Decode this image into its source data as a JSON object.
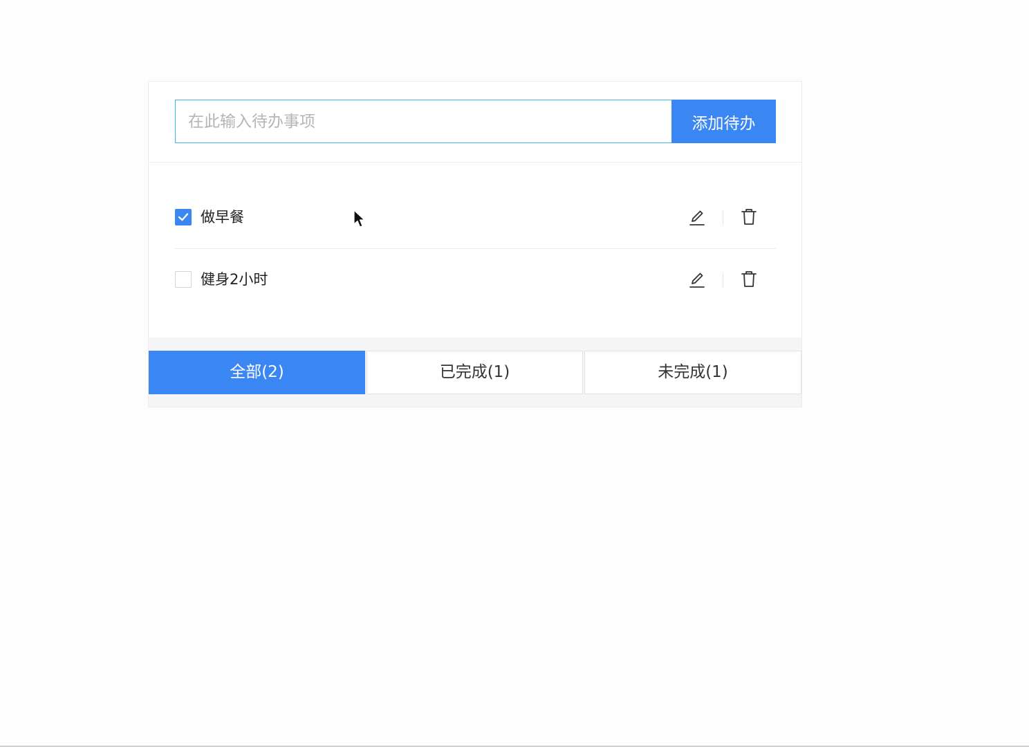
{
  "input": {
    "value": "",
    "placeholder": "在此输入待办事项"
  },
  "add_button_label": "添加待办",
  "todos": [
    {
      "label": "做早餐",
      "checked": true
    },
    {
      "label": "健身2小时",
      "checked": false
    }
  ],
  "filters": [
    {
      "label": "全部(2)",
      "active": true
    },
    {
      "label": "已完成(1)",
      "active": false
    },
    {
      "label": "未完成(1)",
      "active": false
    }
  ],
  "icons": {
    "edit": "pencil-icon",
    "delete": "trash-icon",
    "check": "check-icon",
    "cursor": "mouse-pointer-icon"
  },
  "colors": {
    "accent": "#3a86f2",
    "input_border": "#38b6e8",
    "text": "#222222",
    "placeholder": "#b5b5b5"
  }
}
